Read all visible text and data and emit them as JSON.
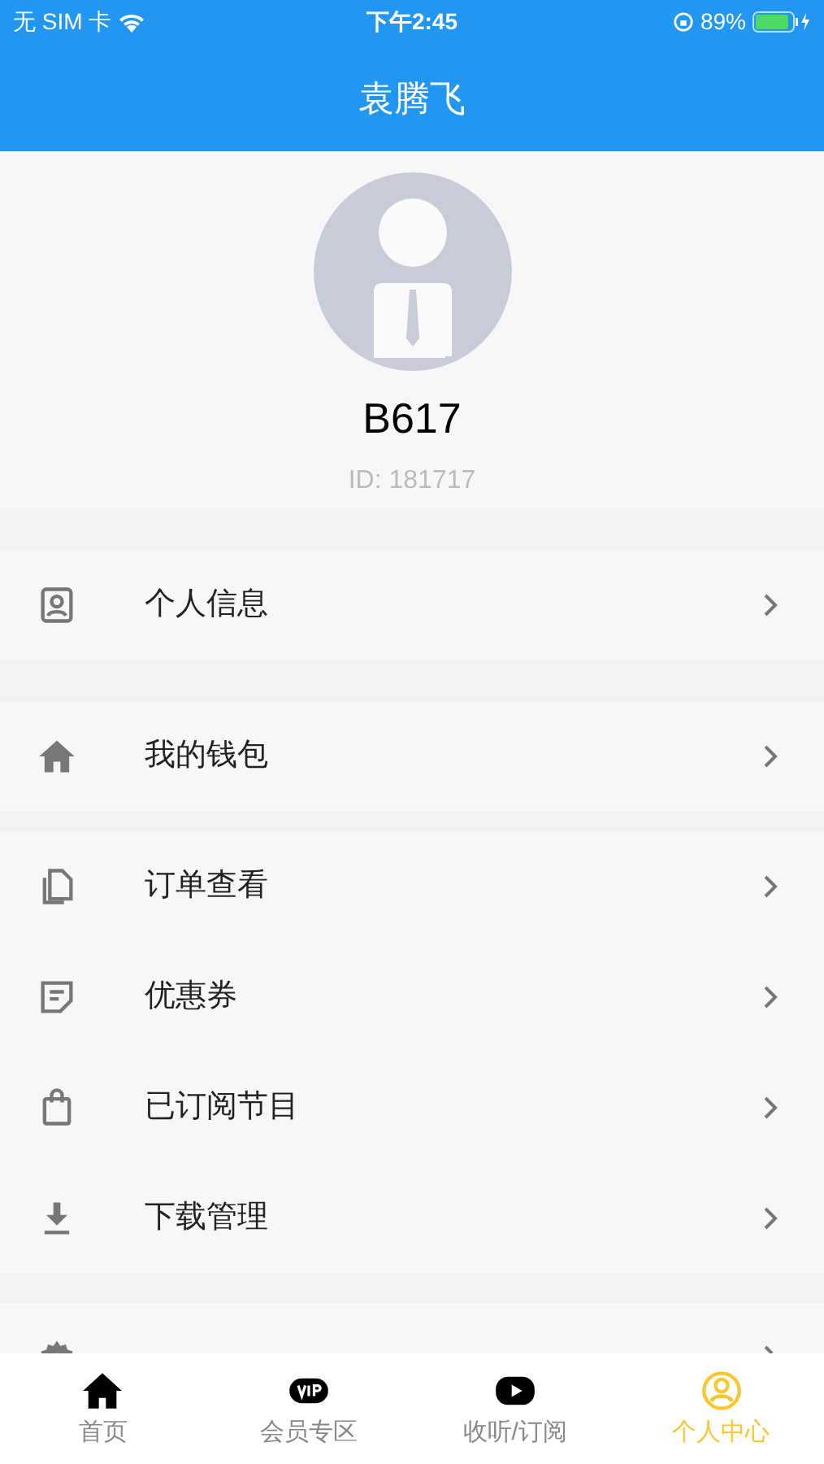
{
  "status_bar": {
    "carrier": "无 SIM 卡",
    "time": "下午2:45",
    "battery": "89%"
  },
  "nav_bar": {
    "title": "袁腾飞"
  },
  "profile": {
    "name": "B617",
    "id": "ID: 181717"
  },
  "menu_groups": [
    {
      "items": [
        {
          "kind": "person",
          "label": "个人信息"
        }
      ]
    },
    {
      "items": [
        {
          "kind": "home",
          "label": "我的钱包"
        }
      ]
    },
    {
      "items": [
        {
          "kind": "copy",
          "label": "订单查看"
        },
        {
          "kind": "note",
          "label": "优惠券"
        },
        {
          "kind": "bag",
          "label": "已订阅节目"
        },
        {
          "kind": "download",
          "label": "下载管理"
        }
      ]
    },
    {
      "items": [
        {
          "kind": "gear"
        }
      ]
    }
  ],
  "tab_bar": [
    {
      "kind": "home",
      "label": "首页",
      "selected": false
    },
    {
      "kind": "vip",
      "label": "会员专区",
      "selected": false
    },
    {
      "kind": "play",
      "label": "收听/订阅",
      "selected": false
    },
    {
      "kind": "user",
      "label": "个人中心",
      "selected": true
    }
  ]
}
